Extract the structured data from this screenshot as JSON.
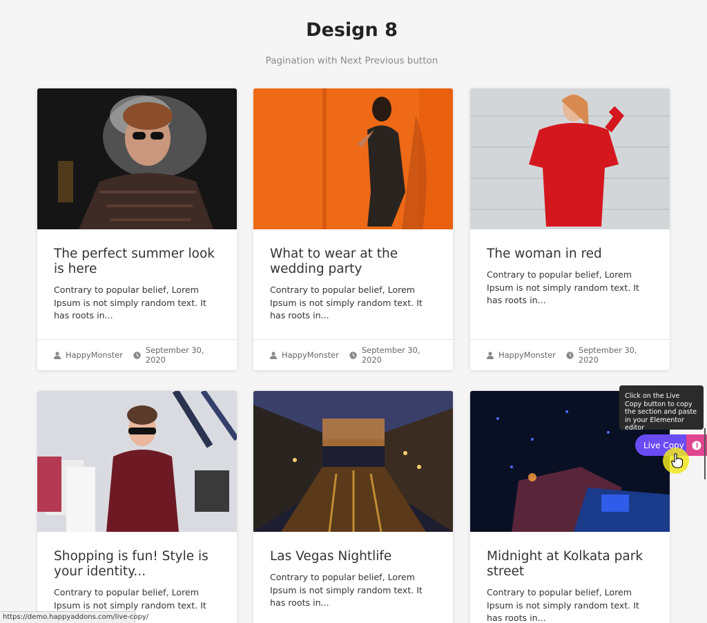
{
  "header": {
    "title": "Design 8",
    "subtitle": "Pagination with Next Previous button"
  },
  "cards": [
    {
      "title": "The perfect summer look is here",
      "excerpt": "Contrary to popular belief, Lorem Ipsum is not simply random text. It has roots in...",
      "author": "HappyMonster",
      "date": "September 30, 2020"
    },
    {
      "title": "What to wear at the wedding party",
      "excerpt": "Contrary to popular belief, Lorem Ipsum is not simply random text. It has roots in...",
      "author": "HappyMonster",
      "date": "September 30, 2020"
    },
    {
      "title": "The woman in red",
      "excerpt": "Contrary to popular belief, Lorem Ipsum is not simply random text. It has roots in...",
      "author": "HappyMonster",
      "date": "September 30, 2020"
    },
    {
      "title": "Shopping is fun! Style is your identity...",
      "excerpt": "Contrary to popular belief, Lorem Ipsum is not simply random text. It has roots in..."
    },
    {
      "title": "Las Vegas Nightlife",
      "excerpt": "Contrary to popular belief, Lorem Ipsum is not simply random text. It has roots in..."
    },
    {
      "title": "Midnight at Kolkata park street",
      "excerpt": "Contrary to popular belief, Lorem Ipsum is not simply random text. It has roots in..."
    }
  ],
  "live_copy": {
    "tooltip": "Click on the Live Copy button to copy the section and paste in your Elementor editor",
    "button_label": "Live Copy"
  },
  "status_bar": {
    "url": "https://demo.happyaddons.com/live-copy/"
  },
  "colors": {
    "live_copy_purple": "#6a4cf5",
    "info_pink": "#e0458f",
    "page_background": "#f5f5f5"
  }
}
